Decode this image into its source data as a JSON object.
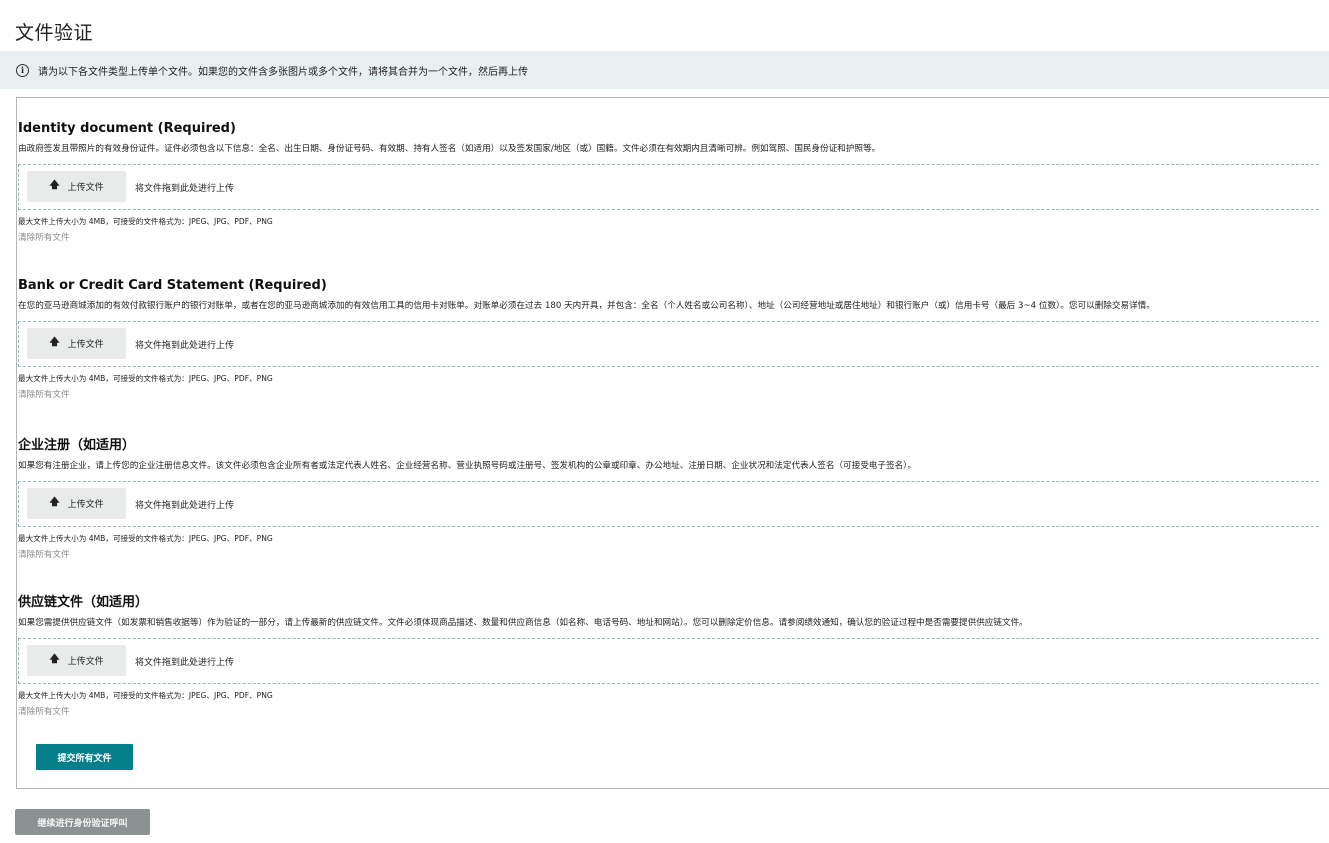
{
  "page": {
    "title": "文件验证"
  },
  "banner": {
    "icon": "info-icon",
    "text": "请为以下各文件类型上传单个文件。如果您的文件含多张图片或多个文件，请将其合并为一个文件，然后再上传"
  },
  "sections": [
    {
      "title": "Identity document (Required)",
      "description": "由政府签发且带照片的有效身份证件。证件必须包含以下信息：全名、出生日期、身份证号码、有效期、持有人签名（如适用）以及签发国家/地区（或）国籍。文件必须在有效期内且清晰可辨。例如驾照、国民身份证和护照等。",
      "upload_label": "上传文件",
      "drop_text": "将文件拖到此处进行上传",
      "limit_text": "最大文件上传大小为 4MB，可接受的文件格式为：JPEG、JPG、PDF、PNG",
      "clear_label": "清除所有文件"
    },
    {
      "title": "Bank or Credit Card Statement (Required)",
      "description": "在您的亚马逊商城添加的有效付款银行账户的银行对账单，或者在您的亚马逊商城添加的有效信用工具的信用卡对账单。对账单必须在过去 180 天内开具，并包含：全名（个人姓名或公司名称）、地址（公司经营地址或居住地址）和银行账户（或）信用卡号（最后 3~4 位数）。您可以删除交易详情。",
      "upload_label": "上传文件",
      "drop_text": "将文件拖到此处进行上传",
      "limit_text": "最大文件上传大小为 4MB，可接受的文件格式为：JPEG、JPG、PDF、PNG",
      "clear_label": "清除所有文件"
    },
    {
      "title": "企业注册（如适用）",
      "description": "如果您有注册企业，请上传您的企业注册信息文件。该文件必须包含企业所有者或法定代表人姓名、企业经营名称、营业执照号码或注册号、签发机构的公章或印章、办公地址、注册日期、企业状况和法定代表人签名（可接受电子签名）。",
      "upload_label": "上传文件",
      "drop_text": "将文件拖到此处进行上传",
      "limit_text": "最大文件上传大小为 4MB，可接受的文件格式为：JPEG、JPG、PDF、PNG",
      "clear_label": "清除所有文件"
    },
    {
      "title": "供应链文件（如适用）",
      "description": "如果您需提供供应链文件（如发票和销售收据等）作为验证的一部分，请上传最新的供应链文件。文件必须体现商品描述、数量和供应商信息（如名称、电话号码、地址和网站）。您可以删除定价信息。请参阅绩效通知，确认您的验证过程中是否需要提供供应链文件。",
      "upload_label": "上传文件",
      "drop_text": "将文件拖到此处进行上传",
      "limit_text": "最大文件上传大小为 4MB，可接受的文件格式为：JPEG、JPG、PDF、PNG",
      "clear_label": "清除所有文件"
    }
  ],
  "actions": {
    "submit_all": "提交所有文件",
    "continue": "继续进行身份验证呼叫"
  },
  "colors": {
    "banner_bg": "#e6f0f1",
    "submit_bg": "#03808a",
    "continue_bg": "#8c9292",
    "dropzone_border": "#8fb5b5"
  }
}
